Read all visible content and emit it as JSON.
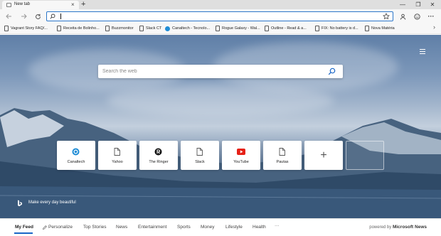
{
  "tab": {
    "title": "New tab",
    "close": "×"
  },
  "newtab_button": "+",
  "window_controls": {
    "minimize": "—",
    "maximize": "❐",
    "close": "✕"
  },
  "toolbar": {
    "address_value": "",
    "address_placeholder": ""
  },
  "favorites": [
    {
      "label": "Vagrant Story FAQ/...",
      "icon": "document-icon"
    },
    {
      "label": "Receita de Bolinho...",
      "icon": "document-icon"
    },
    {
      "label": "Buzzmonitor",
      "icon": "document-icon"
    },
    {
      "label": "Slack CT",
      "icon": "document-icon"
    },
    {
      "label": "Canaltech - Tecnolo...",
      "icon": "canaltech-icon"
    },
    {
      "label": "Rogue Galaxy - Wal...",
      "icon": "document-icon"
    },
    {
      "label": "Outline - Read & a...",
      "icon": "document-icon"
    },
    {
      "label": "FIX: No battery is d...",
      "icon": "document-icon"
    },
    {
      "label": "Nova Matéria",
      "icon": "document-icon"
    }
  ],
  "search": {
    "placeholder": "Search the web"
  },
  "quick_links": [
    {
      "label": "Canaltech",
      "icon": "canaltech-icon"
    },
    {
      "label": "Yahoo",
      "icon": "document-icon"
    },
    {
      "label": "The Ringer",
      "icon": "ringer-icon"
    },
    {
      "label": "Slack",
      "icon": "document-icon"
    },
    {
      "label": "YouTube",
      "icon": "youtube-icon"
    },
    {
      "label": "Pautas",
      "icon": "document-icon"
    }
  ],
  "add_site": "+",
  "bing": {
    "text": "Make every day beautiful"
  },
  "feed": {
    "items": [
      "My Feed",
      "Personalize",
      "Top Stories",
      "News",
      "Entertainment",
      "Sports",
      "Money",
      "Lifestyle",
      "Health",
      "···"
    ],
    "powered_prefix": "powered by",
    "powered_brand": "Microsoft News"
  },
  "colors": {
    "accent": "#2b76c9",
    "youtube": "#e62117",
    "canaltech": "#1f8dd6",
    "feed_underline": "#1a66c7"
  }
}
